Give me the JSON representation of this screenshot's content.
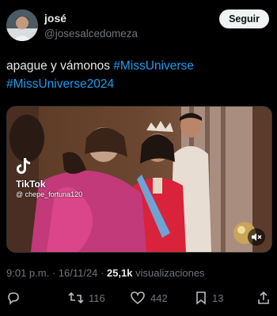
{
  "author": {
    "display_name": "josé",
    "handle": "@josesalcedomeza",
    "avatar_icon": "profile-photo"
  },
  "follow_label": "Seguir",
  "tweet": {
    "text_plain": "apague y vámonos ",
    "hashtags": [
      "#MissUniverse",
      "#MissUniverse2024"
    ]
  },
  "media": {
    "tiktok_label": "TikTok",
    "tiktok_user": "@ chepe_fortuna120",
    "mute_icon": "speaker-muted-icon"
  },
  "meta": {
    "time": "9:01 p.m.",
    "separator": " · ",
    "date": "16/11/24",
    "views_count": "25,1k",
    "views_label": " visualizaciones"
  },
  "actions": {
    "replies": "",
    "retweets": "116",
    "likes": "442",
    "bookmarks": "13"
  },
  "colors": {
    "background": "#000000",
    "text": "#e7e9ea",
    "muted": "#71767b",
    "link": "#1d9bf0"
  }
}
